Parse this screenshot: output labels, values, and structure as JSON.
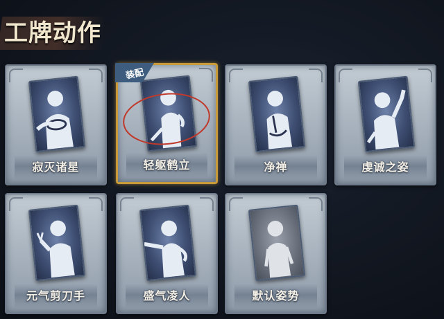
{
  "header": {
    "title": "工牌动作"
  },
  "cards": [
    {
      "label": "寂灭诸星",
      "equipped": false,
      "pose": "pose-clasped-hands-icon"
    },
    {
      "label": "轻躯鹤立",
      "equipped": true,
      "badge": "装配",
      "pose": "pose-crane-stand-icon"
    },
    {
      "label": "净禅",
      "equipped": false,
      "pose": "pose-zen-icon"
    },
    {
      "label": "虔诚之姿",
      "equipped": false,
      "pose": "pose-raised-hand-icon"
    },
    {
      "label": "元气剪刀手",
      "equipped": false,
      "pose": "pose-peace-sign-icon"
    },
    {
      "label": "盛气凌人",
      "equipped": false,
      "pose": "pose-pointing-icon"
    },
    {
      "label": "默认姿势",
      "equipped": false,
      "pose": "pose-default-icon"
    }
  ],
  "colors": {
    "equipped_border": "#c89a3a",
    "badge_bg": "#3d5c7e",
    "ring": "#c0392b"
  }
}
